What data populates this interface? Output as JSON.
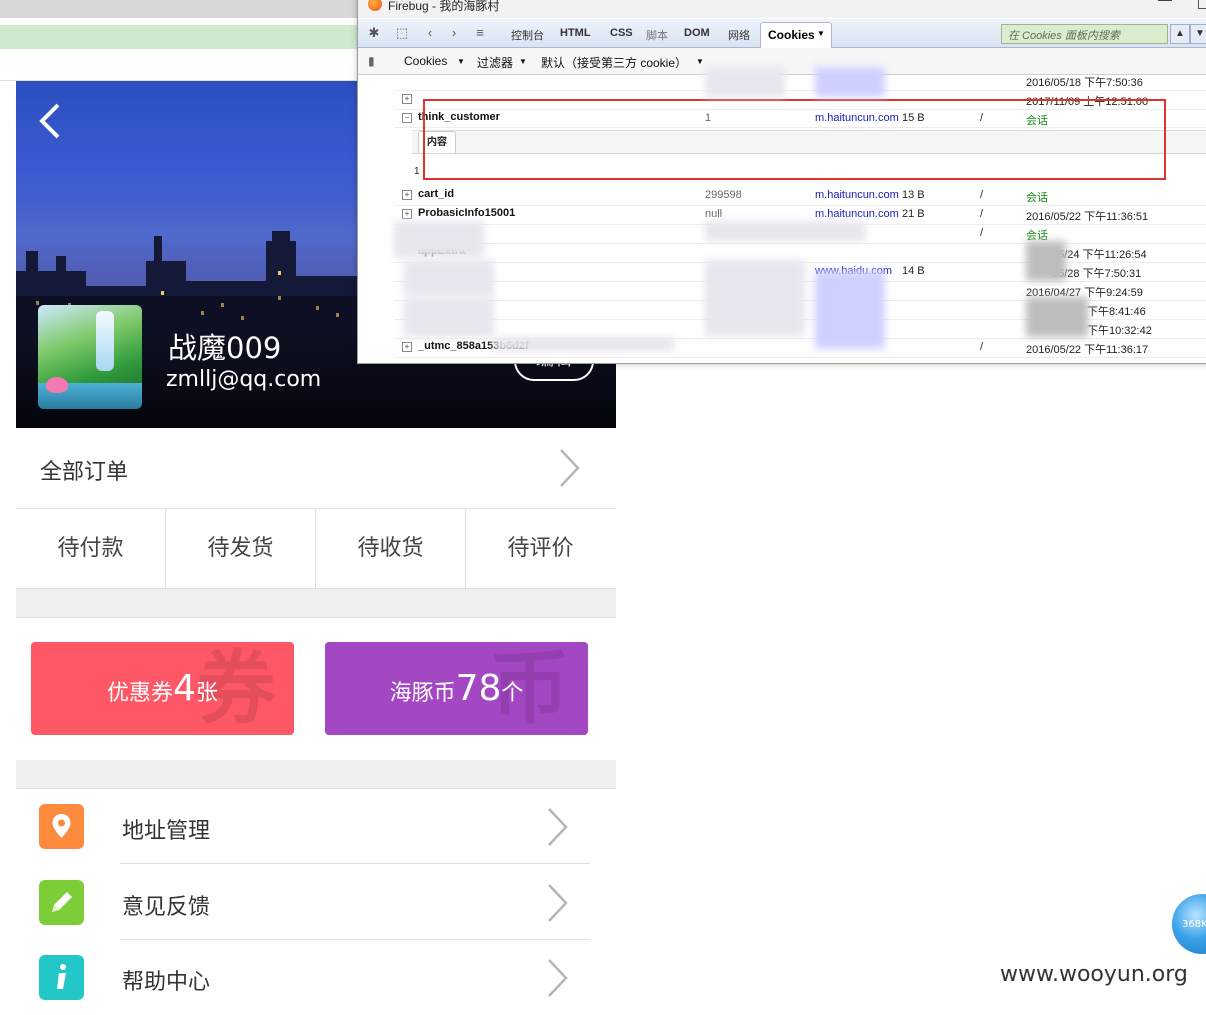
{
  "watermark": "www.wooyun.org",
  "float_ball_text": "368K",
  "mobile": {
    "username": "战魔009",
    "email": "zmllj@qq.com",
    "edit_label": "编辑",
    "all_orders": "全部订单",
    "statuses": [
      "待付款",
      "待发货",
      "待收货",
      "待评价"
    ],
    "coupon": {
      "prefix": "优惠券",
      "count": "4",
      "unit": "张",
      "watermark": "券"
    },
    "coins": {
      "prefix": "海豚币",
      "count": "78",
      "unit": "个",
      "watermark": "币"
    },
    "menu": [
      {
        "label": "地址管理",
        "icon": "location-pin-icon"
      },
      {
        "label": "意见反馈",
        "icon": "pencil-icon"
      },
      {
        "label": "帮助中心",
        "icon": "info-icon"
      }
    ],
    "colors": {
      "coupon": "#fe5766",
      "coins": "#a447c3",
      "address": "#fd8a3d",
      "feedback": "#7dcd39",
      "help": "#23c7c7"
    }
  },
  "firebug": {
    "window_title": "Firebug - 我的海豚村",
    "tabs": [
      "控制台",
      "HTML",
      "CSS",
      "脚本",
      "DOM",
      "网络"
    ],
    "active_tab": "Cookies",
    "search_placeholder": "在 Cookies 面板内搜索",
    "subbar": [
      "Cookies",
      "过滤器",
      "默认（接受第三方 cookie）"
    ],
    "detail_tab": "内容",
    "detail_value": "1",
    "rows": [
      {
        "name": "think_customer",
        "value": "1",
        "domain": "m.haituncun.com",
        "size": "15 B",
        "path": "/",
        "expires": "会话"
      },
      {
        "name": "cart_id",
        "value": "299598",
        "domain": "m.haituncun.com",
        "size": "13 B",
        "path": "/",
        "expires": "会话"
      },
      {
        "name": "ProbasicInfo15001",
        "value": "null",
        "domain": "m.haituncun.com",
        "size": "21 B",
        "path": "/",
        "expires": "2016/05/22 下午11:36:51"
      }
    ],
    "partial_top": [
      "2016/05/18 下午7:50:36",
      "2017/11/09 上午12:51:00"
    ],
    "partial_rows": {
      "r3_path": "/",
      "r3_exp": "会话",
      "r4_name": "appExtra",
      "r4_exp": "05/24 下午11:26:54",
      "r5_domain": "www.baidu.com",
      "r5_size": "14 B",
      "r5_exp": "05/28 下午7:50:31",
      "r6_exp": "2016/04/27 下午9:24:59",
      "r7_exp": "下午8:41:46",
      "r8_exp": "下午10:32:42",
      "r9_name": "_utmc_858a153b6d2f",
      "r9_exp": "2016/05/22 下午11:36:17"
    }
  }
}
